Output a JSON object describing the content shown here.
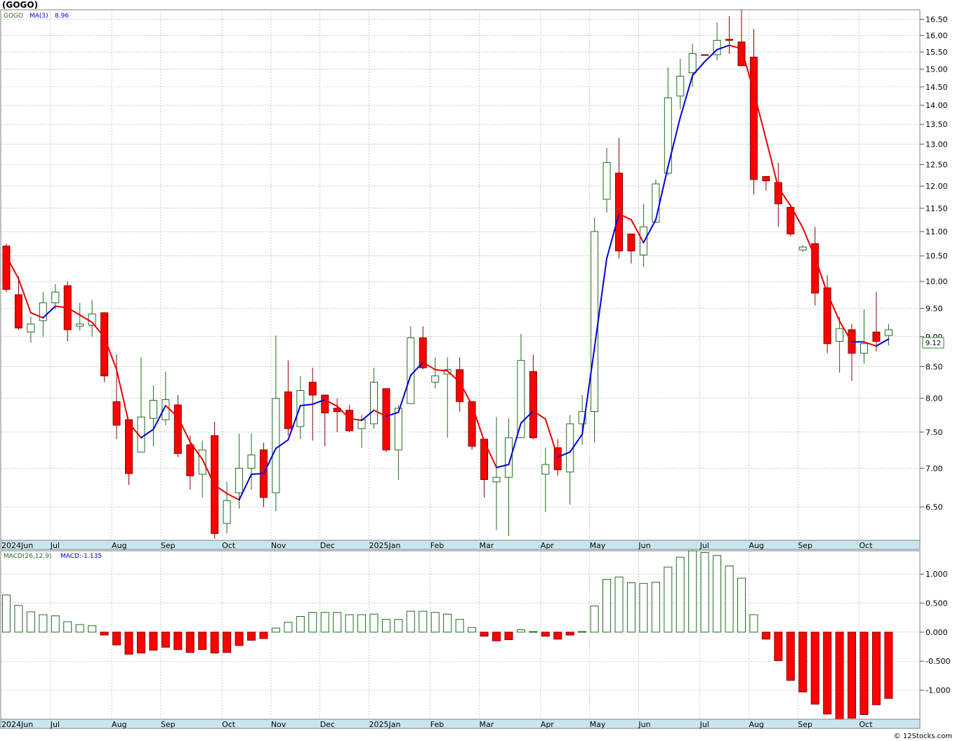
{
  "chart_title": "(GOGO)",
  "copyright": "© 12Stocks.com",
  "colors": {
    "up_fill": "#ffffff",
    "up_stroke": "#1f6e1f",
    "down_fill": "#ff0000",
    "down_stroke": "#880000",
    "ma_up": "#0000dd",
    "ma_down": "#ee0000",
    "axis_band": "#c9e6ef",
    "grid": "#aaaaaa",
    "last_price_box": "#2d8a2d"
  },
  "chart_data": [
    {
      "type": "candlestick",
      "legend": {
        "symbol": "GOGO",
        "ma_label": "MA(3)",
        "ma_value": "8.96"
      },
      "last_price_label": "9.12",
      "ylim": [
        6.1,
        16.8
      ],
      "y_ticks": [
        "6.50",
        "7.00",
        "7.50",
        "8.00",
        "8.50",
        "9.00",
        "9.50",
        "10.00",
        "10.50",
        "11.00",
        "11.50",
        "12.00",
        "12.50",
        "13.00",
        "13.50",
        "14.00",
        "14.50",
        "15.00",
        "15.50",
        "16.00",
        "16.50"
      ],
      "x_labels": [
        {
          "label": "2024Jun",
          "week": 0
        },
        {
          "label": "Jul",
          "week": 4
        },
        {
          "label": "Aug",
          "week": 9
        },
        {
          "label": "Sep",
          "week": 13
        },
        {
          "label": "Oct",
          "week": 18
        },
        {
          "label": "Nov",
          "week": 22
        },
        {
          "label": "Dec",
          "week": 26
        },
        {
          "label": "2025Jan",
          "week": 30
        },
        {
          "label": "Feb",
          "week": 35
        },
        {
          "label": "Mar",
          "week": 39
        },
        {
          "label": "Apr",
          "week": 44
        },
        {
          "label": "May",
          "week": 48
        },
        {
          "label": "Jun",
          "week": 52
        },
        {
          "label": "Jul",
          "week": 57
        },
        {
          "label": "Aug",
          "week": 61
        },
        {
          "label": "Sep",
          "week": 65
        },
        {
          "label": "Oct",
          "week": 70
        }
      ],
      "candles": [
        [
          10.7,
          10.75,
          9.8,
          9.85
        ],
        [
          9.75,
          10.1,
          9.12,
          9.15
        ],
        [
          9.08,
          9.35,
          8.9,
          9.22
        ],
        [
          9.28,
          9.8,
          9.0,
          9.6
        ],
        [
          9.6,
          9.95,
          9.48,
          9.8
        ],
        [
          9.92,
          10.0,
          8.92,
          9.12
        ],
        [
          9.18,
          9.6,
          9.1,
          9.22
        ],
        [
          9.2,
          9.65,
          9.0,
          9.4
        ],
        [
          9.42,
          9.42,
          8.25,
          8.35
        ],
        [
          7.95,
          8.7,
          7.4,
          7.6
        ],
        [
          7.68,
          7.68,
          6.78,
          6.93
        ],
        [
          7.22,
          8.65,
          7.22,
          7.72
        ],
        [
          7.7,
          8.2,
          7.3,
          7.97
        ],
        [
          7.68,
          8.42,
          7.6,
          7.98
        ],
        [
          7.9,
          8.05,
          7.15,
          7.2
        ],
        [
          7.32,
          7.45,
          6.72,
          6.9
        ],
        [
          6.92,
          7.38,
          6.62,
          7.25
        ],
        [
          7.45,
          7.65,
          6.12,
          6.18
        ],
        [
          6.3,
          6.82,
          6.18,
          6.58
        ],
        [
          6.68,
          7.48,
          6.48,
          7.0
        ],
        [
          7.0,
          7.48,
          6.72,
          7.18
        ],
        [
          7.25,
          7.35,
          6.5,
          6.62
        ],
        [
          6.68,
          9.02,
          6.45,
          8.0
        ],
        [
          8.1,
          8.6,
          7.45,
          7.55
        ],
        [
          7.58,
          8.35,
          7.4,
          8.12
        ],
        [
          8.25,
          8.48,
          7.38,
          8.05
        ],
        [
          8.05,
          8.05,
          7.3,
          7.78
        ],
        [
          7.85,
          8.0,
          7.5,
          7.8
        ],
        [
          7.82,
          7.9,
          7.5,
          7.52
        ],
        [
          7.55,
          7.75,
          7.28,
          7.68
        ],
        [
          7.62,
          8.48,
          7.55,
          8.25
        ],
        [
          8.15,
          8.15,
          7.22,
          7.25
        ],
        [
          7.25,
          7.9,
          6.85,
          7.85
        ],
        [
          7.92,
          9.18,
          7.92,
          8.98
        ],
        [
          8.98,
          9.18,
          8.45,
          8.48
        ],
        [
          8.25,
          8.65,
          8.15,
          8.35
        ],
        [
          8.38,
          8.65,
          7.42,
          8.45
        ],
        [
          8.45,
          8.65,
          7.8,
          7.95
        ],
        [
          7.95,
          7.95,
          7.25,
          7.3
        ],
        [
          7.4,
          7.4,
          6.62,
          6.85
        ],
        [
          6.82,
          7.72,
          6.22,
          6.88
        ],
        [
          6.88,
          7.7,
          6.15,
          7.42
        ],
        [
          7.42,
          9.05,
          7.42,
          8.6
        ],
        [
          8.42,
          8.7,
          7.4,
          7.42
        ],
        [
          6.92,
          7.28,
          6.44,
          7.05
        ],
        [
          7.28,
          7.4,
          6.9,
          6.98
        ],
        [
          6.95,
          7.75,
          6.53,
          7.62
        ],
        [
          7.62,
          8.05,
          7.32,
          7.8
        ],
        [
          7.8,
          11.3,
          7.35,
          11.0
        ],
        [
          11.7,
          12.9,
          11.4,
          12.55
        ],
        [
          12.3,
          13.15,
          10.45,
          10.6
        ],
        [
          10.95,
          10.95,
          10.35,
          10.6
        ],
        [
          10.52,
          11.6,
          10.28,
          11.1
        ],
        [
          11.2,
          12.15,
          11.2,
          12.05
        ],
        [
          12.3,
          15.05,
          12.25,
          14.2
        ],
        [
          14.25,
          15.3,
          13.9,
          14.8
        ],
        [
          14.9,
          15.75,
          14.5,
          15.45
        ],
        [
          15.42,
          15.42,
          15.4,
          15.4
        ],
        [
          15.42,
          16.4,
          15.25,
          15.85
        ],
        [
          15.88,
          16.6,
          15.45,
          15.85
        ],
        [
          15.8,
          16.8,
          15.15,
          15.1
        ],
        [
          15.35,
          16.2,
          11.8,
          12.15
        ],
        [
          12.22,
          12.22,
          11.9,
          12.12
        ],
        [
          12.08,
          12.55,
          11.1,
          11.6
        ],
        [
          11.52,
          11.55,
          10.9,
          10.95
        ],
        [
          10.62,
          10.72,
          10.58,
          10.68
        ],
        [
          10.75,
          11.1,
          9.55,
          9.78
        ],
        [
          9.88,
          10.12,
          8.72,
          8.88
        ],
        [
          8.92,
          9.35,
          8.4,
          9.14
        ],
        [
          9.12,
          9.22,
          8.27,
          8.72
        ],
        [
          8.72,
          9.48,
          8.55,
          8.88
        ],
        [
          9.08,
          9.8,
          8.75,
          8.92
        ],
        [
          9.02,
          9.22,
          8.85,
          9.12
        ]
      ],
      "ma": [
        10.5,
        10.05,
        9.42,
        9.33,
        9.54,
        9.51,
        9.38,
        9.25,
        8.99,
        8.45,
        7.63,
        7.42,
        7.54,
        7.89,
        7.72,
        7.36,
        7.12,
        6.78,
        6.67,
        6.59,
        6.92,
        6.93,
        7.27,
        7.39,
        7.89,
        7.91,
        7.98,
        7.88,
        7.7,
        7.67,
        7.82,
        7.73,
        7.79,
        8.36,
        8.57,
        8.45,
        8.43,
        8.25,
        7.9,
        7.37,
        7.01,
        7.05,
        7.63,
        7.81,
        7.69,
        7.15,
        7.22,
        7.47,
        8.81,
        10.45,
        11.38,
        11.25,
        10.77,
        11.25,
        12.45,
        13.68,
        14.82,
        15.22,
        15.57,
        15.7,
        15.6,
        14.37,
        13.12,
        11.96,
        11.56,
        11.08,
        10.47,
        9.78,
        9.27,
        8.91,
        8.91,
        8.84,
        8.96
      ]
    },
    {
      "type": "bar",
      "legend": {
        "label": "MACD(26,12,9)",
        "value_label": "MACD:-1.135"
      },
      "ylim": [
        -1.5,
        1.4
      ],
      "y_ticks": [
        "-1.000",
        "-0.500",
        "0.000",
        "0.500",
        "1.000"
      ],
      "values": [
        0.64,
        0.46,
        0.35,
        0.3,
        0.28,
        0.18,
        0.13,
        0.11,
        -0.05,
        -0.22,
        -0.38,
        -0.36,
        -0.31,
        -0.26,
        -0.3,
        -0.35,
        -0.3,
        -0.36,
        -0.35,
        -0.23,
        -0.14,
        -0.11,
        0.07,
        0.17,
        0.27,
        0.34,
        0.34,
        0.34,
        0.3,
        0.3,
        0.31,
        0.22,
        0.22,
        0.36,
        0.36,
        0.34,
        0.31,
        0.22,
        0.08,
        -0.07,
        -0.15,
        -0.13,
        0.04,
        0.01,
        -0.07,
        -0.12,
        -0.05,
        0.01,
        0.45,
        0.91,
        0.95,
        0.85,
        0.84,
        0.86,
        1.12,
        1.29,
        1.4,
        1.37,
        1.32,
        1.14,
        0.93,
        0.3,
        -0.12,
        -0.49,
        -0.83,
        -1.03,
        -1.24,
        -1.41,
        -1.5,
        -1.48,
        -1.42,
        -1.25,
        -1.14
      ],
      "x_labels": [
        {
          "label": "2024Jun",
          "week": 0
        },
        {
          "label": "Jul",
          "week": 4
        },
        {
          "label": "Aug",
          "week": 9
        },
        {
          "label": "Sep",
          "week": 13
        },
        {
          "label": "Oct",
          "week": 18
        },
        {
          "label": "Nov",
          "week": 22
        },
        {
          "label": "Dec",
          "week": 26
        },
        {
          "label": "2025Jan",
          "week": 30
        },
        {
          "label": "Feb",
          "week": 35
        },
        {
          "label": "Mar",
          "week": 39
        },
        {
          "label": "Apr",
          "week": 44
        },
        {
          "label": "May",
          "week": 48
        },
        {
          "label": "Jun",
          "week": 52
        },
        {
          "label": "Jul",
          "week": 57
        },
        {
          "label": "Aug",
          "week": 61
        },
        {
          "label": "Sep",
          "week": 65
        },
        {
          "label": "Oct",
          "week": 70
        }
      ]
    }
  ]
}
